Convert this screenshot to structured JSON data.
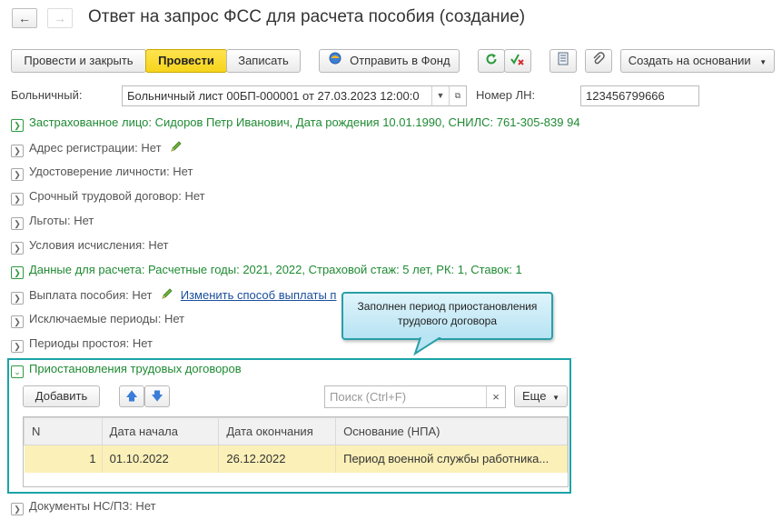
{
  "window": {
    "title": "Ответ на запрос ФСС для расчета пособия (создание)",
    "nav_back": "🡐",
    "nav_forward": "🡒"
  },
  "toolbar": {
    "post_and_close": "Провести и закрыть",
    "post": "Провести",
    "save": "Записать",
    "send_to_fund": "Отправить в Фонд",
    "create_based_on": "Создать на основании"
  },
  "fields": {
    "sick_leave_label": "Больничный:",
    "sick_leave_value": "Больничный лист 00БП-000001 от 27.03.2023 12:00:0",
    "ln_number_label": "Номер ЛН:",
    "ln_number_value": "123456799666"
  },
  "groups": {
    "insured": "Застрахованное лицо: Сидоров Петр Иванович, Дата рождения 10.01.1990, СНИЛС: 761-305-839 94",
    "address": "Адрес регистрации: Нет",
    "id_doc": "Удостоверение личности: Нет",
    "fixed_contract": "Срочный трудовой договор: Нет",
    "benefits": "Льготы: Нет",
    "calc_conditions": "Условия исчисления: Нет",
    "calc_data": "Данные для расчета: Расчетные годы: 2021, 2022, Страховой стаж: 5 лет, РК: 1, Ставок: 1",
    "payment": "Выплата пособия: Нет",
    "payment_link": "Изменить способ выплаты п",
    "excluded_periods": "Исключаемые периоды: Нет",
    "idle_periods": "Периоды простоя: Нет",
    "suspensions": "Приостановления трудовых договоров",
    "accident_docs": "Документы НС/ПЗ: Нет"
  },
  "callout": {
    "line1": "Заполнен период приостановления",
    "line2": "трудового договора"
  },
  "suspensions_panel": {
    "add": "Добавить",
    "search_placeholder": "Поиск (Ctrl+F)",
    "search_clear": "×",
    "more": "Еще",
    "columns": [
      "N",
      "Дата начала",
      "Дата окончания",
      "Основание (НПА)"
    ],
    "rows": [
      {
        "n": "1",
        "start": "01.10.2022",
        "end": "26.12.2022",
        "basis": "Период военной службы работника..."
      }
    ]
  },
  "colors": {
    "accent_yellow": "#f6d41c",
    "group_green": "#1f8a33",
    "highlight_teal": "#1aa3a8",
    "row_selected": "#fbf0b8"
  }
}
